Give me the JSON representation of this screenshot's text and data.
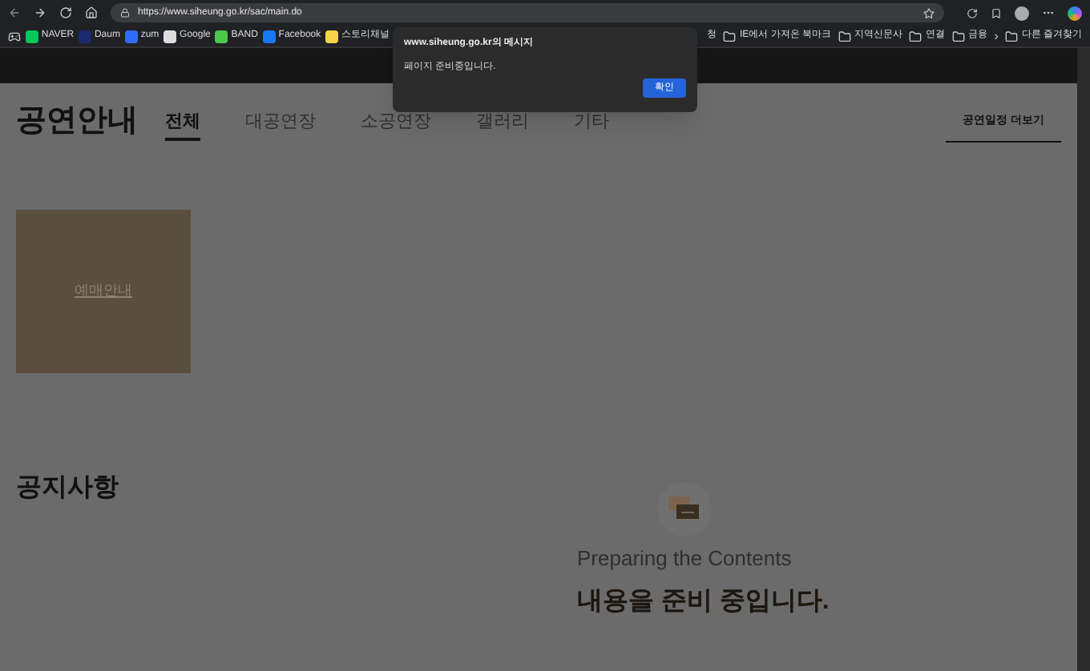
{
  "browser": {
    "url": "https://www.siheung.go.kr/sac/main.do",
    "bookmarks": [
      {
        "kind": "site",
        "label": "NAVER",
        "color": "#03c75a"
      },
      {
        "kind": "site",
        "label": "Daum",
        "color": "#1a2a6c"
      },
      {
        "kind": "site",
        "label": "zum",
        "color": "#2f6bff"
      },
      {
        "kind": "site",
        "label": "Google",
        "color": "#dddddd"
      },
      {
        "kind": "site",
        "label": "BAND",
        "color": "#4cc84c"
      },
      {
        "kind": "site",
        "label": "Facebook",
        "color": "#1877f2"
      },
      {
        "kind": "site",
        "label": "스토리채널",
        "color": "#f5d547"
      }
    ],
    "bookmarks_right": [
      {
        "kind": "text",
        "label": "청"
      },
      {
        "kind": "folder",
        "label": "IE에서 가져온 북마크"
      },
      {
        "kind": "folder",
        "label": "지역신문사"
      },
      {
        "kind": "folder",
        "label": "연결"
      },
      {
        "kind": "folder",
        "label": "금융"
      },
      {
        "kind": "chevron",
        "label": "›"
      },
      {
        "kind": "folder",
        "label": "다른 즐겨찾기"
      }
    ]
  },
  "dialog": {
    "title": "www.siheung.go.kr의 메시지",
    "message": "페이지 준비중입니다.",
    "button": "확인"
  },
  "page": {
    "title": "공연안내",
    "tabs": [
      {
        "label": "전체",
        "selected": true
      },
      {
        "label": "대공연장",
        "selected": false
      },
      {
        "label": "소공연장",
        "selected": false
      },
      {
        "label": "갤러리",
        "selected": false
      },
      {
        "label": "기타",
        "selected": false
      }
    ],
    "more_link": "공연일정 더보기",
    "card": {
      "label": "예매안내"
    },
    "notice": {
      "title": "공지사항",
      "subtitle": "Preparing the Contents",
      "message": "내용을 준비 중입니다."
    }
  }
}
